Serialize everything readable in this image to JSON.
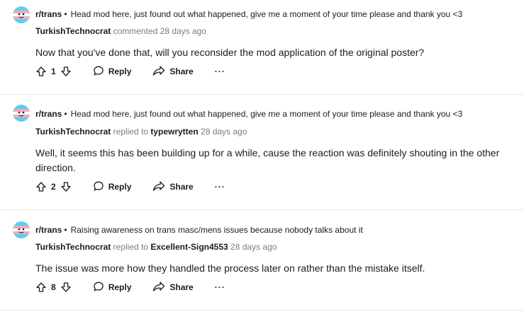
{
  "comments": [
    {
      "subreddit": "r/trans",
      "separator": "•",
      "post_title": "Head mod here, just found out what happened, give me a moment of your time please and thank you <3",
      "author": "TurkishTechnocrat",
      "action_text": "commented",
      "reply_target": "",
      "time": "28 days ago",
      "body": "Now that you've done that, will you reconsider the mod application of the original poster?",
      "votes": "1",
      "reply_label": "Reply",
      "share_label": "Share",
      "more_label": "···"
    },
    {
      "subreddit": "r/trans",
      "separator": "•",
      "post_title": "Head mod here, just found out what happened, give me a moment of your time please and thank you <3",
      "author": "TurkishTechnocrat",
      "action_text": "replied to",
      "reply_target": "typewrytten",
      "time": "28 days ago",
      "body": "Well, it seems this has been building up for a while, cause the reaction was definitely shouting in the other direction.",
      "votes": "2",
      "reply_label": "Reply",
      "share_label": "Share",
      "more_label": "···"
    },
    {
      "subreddit": "r/trans",
      "separator": "•",
      "post_title": "Raising awareness on trans masc/mens issues because nobody talks about it",
      "author": "TurkishTechnocrat",
      "action_text": "replied to",
      "reply_target": "Excellent-Sign4553",
      "time": "28 days ago",
      "body": "The issue was more how they handled the process later on rather than the mistake itself.",
      "votes": "8",
      "reply_label": "Reply",
      "share_label": "Share",
      "more_label": "···"
    }
  ],
  "icons": {
    "avatar": "subreddit-avatar-icon",
    "upvote": "upvote-arrow-icon",
    "downvote": "downvote-arrow-icon",
    "reply": "speech-bubble-icon",
    "share": "share-arrow-icon"
  },
  "colors": {
    "flag_blue": "#5bcefa",
    "flag_pink": "#f5a9b8",
    "flag_white": "#ffffff",
    "meta_gray": "#7c7c7c",
    "divider": "#e5e7e8"
  }
}
